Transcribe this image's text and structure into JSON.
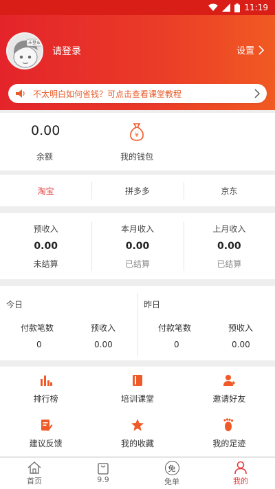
{
  "status_bar": {
    "time": "11:19"
  },
  "header": {
    "avatar_text": "未登录",
    "login_label": "请登录",
    "settings_label": "设置"
  },
  "notice": {
    "text": "不太明白如何省钱？可点击查看课堂教程"
  },
  "balance": {
    "value": "0.00",
    "label": "余额",
    "wallet_label": "我的钱包"
  },
  "platform_tabs": [
    {
      "label": "淘宝",
      "active": true
    },
    {
      "label": "拼多多",
      "active": false
    },
    {
      "label": "京东",
      "active": false
    }
  ],
  "income": [
    {
      "label": "预收入",
      "value": "0.00",
      "status": "未结算"
    },
    {
      "label": "本月收入",
      "value": "0.00",
      "status": "已结算"
    },
    {
      "label": "上月收入",
      "value": "0.00",
      "status": "已结算"
    }
  ],
  "daily": {
    "today": {
      "title": "今日",
      "count_label": "付款笔数",
      "income_label": "预收入",
      "count": "0",
      "income": "0.00"
    },
    "yesterday": {
      "title": "昨日",
      "count_label": "付款笔数",
      "income_label": "预收入",
      "count": "0",
      "income": "0.00"
    }
  },
  "tools": [
    {
      "label": "排行榜",
      "icon": "bar-chart-icon"
    },
    {
      "label": "培训课堂",
      "icon": "book-icon"
    },
    {
      "label": "邀请好友",
      "icon": "user-add-icon"
    },
    {
      "label": "建议反馈",
      "icon": "edit-icon"
    },
    {
      "label": "我的收藏",
      "icon": "star-icon"
    },
    {
      "label": "我的足迹",
      "icon": "footprint-icon"
    }
  ],
  "tab_bar": [
    {
      "label": "首页",
      "icon": "home-icon",
      "active": false
    },
    {
      "label": "9.9",
      "icon": "bag-icon",
      "active": false
    },
    {
      "label": "免单",
      "icon": "free-icon",
      "icon_text": "免",
      "active": false
    },
    {
      "label": "我的",
      "icon": "user-icon",
      "active": true
    }
  ],
  "colors": {
    "brand_red": "#e4242a",
    "brand_orange": "#f15a22",
    "accent": "#e4393c",
    "icon_orange": "#f05a28"
  }
}
